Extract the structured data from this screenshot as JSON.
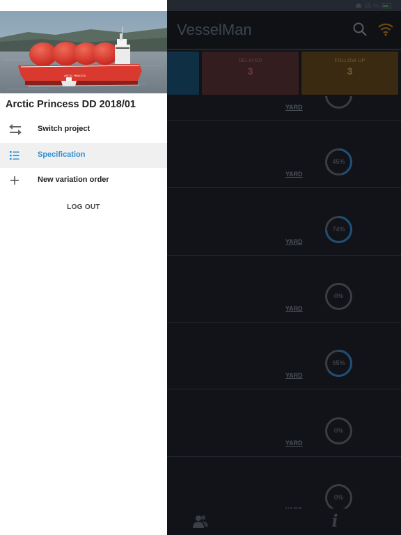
{
  "status_bar": {
    "battery_text": "65 %"
  },
  "app": {
    "title": "VesselMan",
    "summary": {
      "delayed_label": "DELAYED",
      "delayed_count": "3",
      "follow_label": "FOLLOW UP",
      "follow_count": "3"
    },
    "rows": [
      {
        "tag": "YARD",
        "progress": null,
        "progress_label": ""
      },
      {
        "tag": "YARD",
        "progress": 0.45,
        "progress_label": "45%"
      },
      {
        "tag": "YARD",
        "progress": 0.74,
        "progress_label": "74%"
      },
      {
        "tag": "YARD",
        "progress": 0.0,
        "progress_label": "0%"
      },
      {
        "tag": "YARD",
        "progress": 0.65,
        "progress_label": "65%"
      },
      {
        "tag": "YARD",
        "progress": 0.0,
        "progress_label": "0%"
      },
      {
        "tag": "YARD",
        "progress": 0.0,
        "progress_label": "0%"
      }
    ]
  },
  "drawer": {
    "project_title": "Arctic Princess DD 2018/01",
    "menu": [
      {
        "label": "Switch project",
        "icon": "swap-arrows-icon",
        "active": false
      },
      {
        "label": "Specification",
        "icon": "list-icon",
        "active": true
      },
      {
        "label": "New variation order",
        "icon": "plus-icon",
        "active": false
      }
    ],
    "logout_label": "LOG OUT",
    "ship_name_on_hull": "ARCTIC PRINCESS"
  },
  "colors": {
    "accent": "#2d8fd3",
    "ship_hull": "#d9392e",
    "wifi_orange": "#e08a1a",
    "delayed_bg": "#341d1e",
    "follow_bg": "#3a2a12"
  }
}
